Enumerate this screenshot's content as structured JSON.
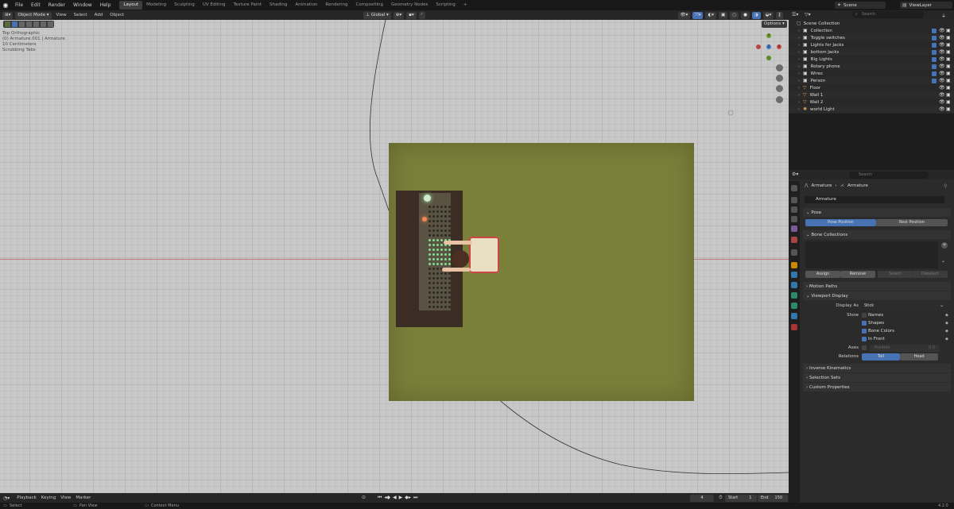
{
  "topbar": {
    "menus": [
      "File",
      "Edit",
      "Render",
      "Window",
      "Help"
    ],
    "workspaces": [
      "Layout",
      "Modeling",
      "Sculpting",
      "UV Editing",
      "Texture Paint",
      "Shading",
      "Animation",
      "Rendering",
      "Compositing",
      "Geometry Nodes",
      "Scripting",
      "+"
    ],
    "active_workspace": "Layout",
    "scene": "Scene",
    "view_layer": "ViewLayer"
  },
  "viewport": {
    "mode": "Object Mode",
    "menus": [
      "View",
      "Select",
      "Add",
      "Object"
    ],
    "orientation": "Global",
    "options": "Options",
    "overlay": [
      "Top Orthographic",
      "(0) Armature.001 | Armature",
      "10 Centimeters",
      "Scrubbing Tabs"
    ],
    "gizmo": {
      "x": "X",
      "y": "Y",
      "z": "Z"
    }
  },
  "outliner": {
    "search_placeholder": "Search",
    "root": "Scene Collection",
    "items": [
      {
        "label": "Collection",
        "type": "collection"
      },
      {
        "label": "Toggle switches",
        "type": "collection"
      },
      {
        "label": "Lights for Jacks",
        "type": "collection"
      },
      {
        "label": "bottom Jacks",
        "type": "collection"
      },
      {
        "label": "Big Lights",
        "type": "collection"
      },
      {
        "label": "Rotary phone",
        "type": "collection"
      },
      {
        "label": "Wires",
        "type": "collection"
      },
      {
        "label": "Person",
        "type": "collection"
      },
      {
        "label": "Floor",
        "type": "mesh"
      },
      {
        "label": "Wall 1",
        "type": "mesh"
      },
      {
        "label": "Wall 2",
        "type": "mesh"
      },
      {
        "label": "world Light",
        "type": "light"
      }
    ]
  },
  "properties": {
    "search_placeholder": "Search",
    "breadcrumb": [
      "Armature",
      "Armature"
    ],
    "name": "Armature",
    "pose": {
      "title": "Pose",
      "pose_position": "Pose Position",
      "rest_position": "Rest Position"
    },
    "bone_collections": {
      "title": "Bone Collections",
      "assign": "Assign",
      "remove": "Remove",
      "select": "Select",
      "deselect": "Deselect"
    },
    "motion_paths": "Motion Paths",
    "viewport_display": {
      "title": "Viewport Display",
      "display_as_label": "Display As",
      "display_as": "Stick",
      "show_label": "Show",
      "names": "Names",
      "shapes": "Shapes",
      "bone_colors": "Bone Colors",
      "in_front": "In Front",
      "axes_label": "Axes",
      "position_label": "Position",
      "position_value": "0.0",
      "relations_label": "Relations",
      "tail": "Tail",
      "head": "Head"
    },
    "ik": "Inverse Kinematics",
    "selection_sets": "Selection Sets",
    "custom_props": "Custom Properties"
  },
  "timeline": {
    "menus": [
      "Playback",
      "Keying",
      "View",
      "Marker"
    ],
    "frame": "4",
    "start_label": "Start",
    "start": "1",
    "end_label": "End",
    "end": "150"
  },
  "status": {
    "select": "Select",
    "pan": "Pan View",
    "context": "Context Menu",
    "version": "4.2.0"
  },
  "colors": {
    "accent": "#4772b3",
    "floor": "#7a7f3a",
    "bg": "#1d1d1d"
  }
}
